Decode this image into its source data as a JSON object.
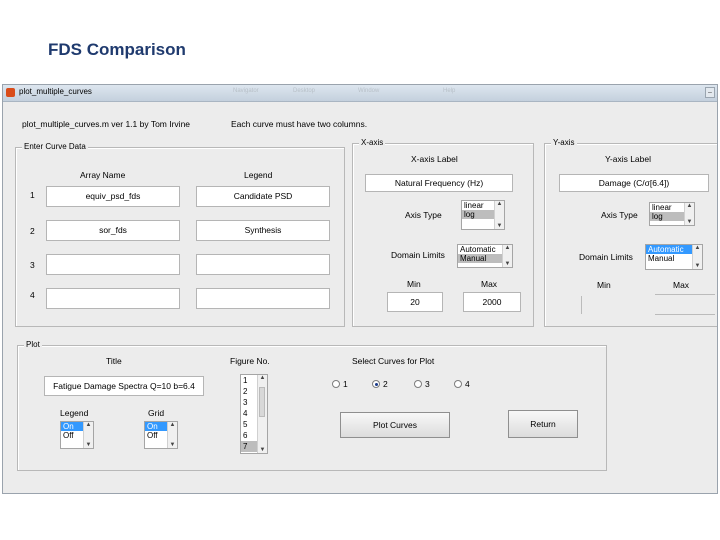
{
  "slide": {
    "title": "FDS Comparison"
  },
  "window": {
    "title": "plot_multiple_curves",
    "blurred_menu": [
      "Navigator",
      "Desktop",
      "Window",
      "Help"
    ],
    "controls": [
      "–",
      "□",
      "✕"
    ]
  },
  "header": {
    "version_text": "plot_multiple_curves.m ver 1.1   by Tom Irvine",
    "note_text": "Each curve must have two columns."
  },
  "curves": {
    "panel_title": "Enter Curve Data",
    "array_header": "Array Name",
    "legend_header": "Legend",
    "rows": [
      {
        "index": "1",
        "array": "equiv_psd_fds",
        "legend": "Candidate PSD"
      },
      {
        "index": "2",
        "array": "sor_fds",
        "legend": "Synthesis"
      },
      {
        "index": "3",
        "array": "",
        "legend": ""
      },
      {
        "index": "4",
        "array": "",
        "legend": ""
      }
    ]
  },
  "xaxis": {
    "panel_title": "X-axis",
    "label_header": "X-axis Label",
    "label_value": "Natural Frequency (Hz)",
    "type_label": "Axis Type",
    "type_options": [
      "linear",
      "log"
    ],
    "type_selected": "log",
    "domain_label": "Domain Limits",
    "domain_options": [
      "Automatic",
      "Manual"
    ],
    "domain_selected": "Manual",
    "min_label": "Min",
    "max_label": "Max",
    "min_value": "20",
    "max_value": "2000"
  },
  "yaxis": {
    "panel_title": "Y-axis",
    "label_header": "Y-axis Label",
    "label_value": "Damage (C/σ[6.4])",
    "type_label": "Axis Type",
    "type_options": [
      "linear",
      "log"
    ],
    "type_selected": "log",
    "domain_label": "Domain Limits",
    "domain_options": [
      "Automatic",
      "Manual"
    ],
    "domain_selected": "Automatic",
    "min_label": "Min",
    "max_label": "Max"
  },
  "plot": {
    "panel_title": "Plot",
    "title_label": "Title",
    "title_value": "Fatigue Damage Spectra Q=10 b=6.4",
    "figure_label": "Figure No.",
    "figure_options": [
      "1",
      "2",
      "3",
      "4",
      "5",
      "6",
      "7"
    ],
    "figure_selected": "7",
    "select_label": "Select Curves for Plot",
    "radio_options": [
      "1",
      "2",
      "3",
      "4"
    ],
    "radio_selected": "2",
    "legend_label": "Legend",
    "legend_options": [
      "On",
      "Off"
    ],
    "legend_selected": "On",
    "grid_label": "Grid",
    "grid_options": [
      "On",
      "Off"
    ],
    "grid_selected": "On",
    "plot_button": "Plot Curves",
    "return_button": "Return"
  },
  "colors": {
    "slide_title": "#1f3a6e",
    "window_bg": "#ececec",
    "selection": "#3399ff"
  }
}
